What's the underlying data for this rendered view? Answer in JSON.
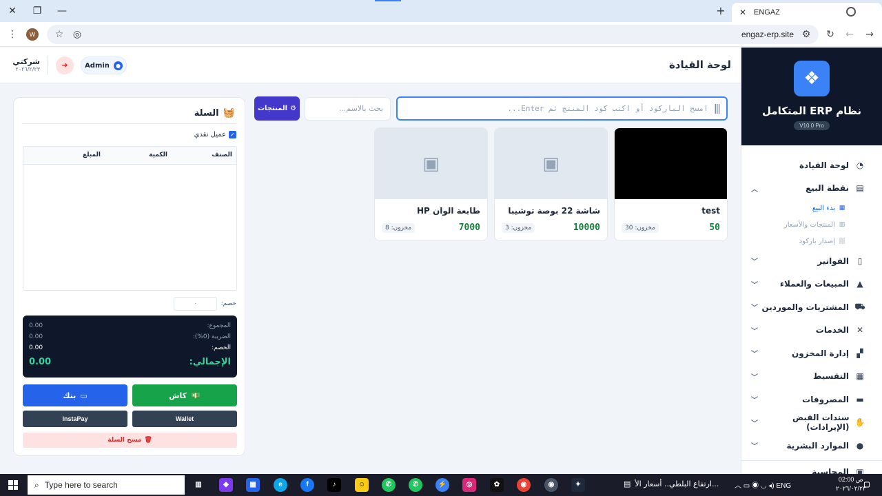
{
  "browser": {
    "tab_title": "ENGAZ",
    "url": "engaz-erp.site",
    "profile_initial": "W"
  },
  "sidebar": {
    "brand_title": "نظام ERP المتكامل",
    "version": "V10.0 Pro",
    "items": [
      {
        "label": "لوحة القيادة",
        "icon": "chart-pie-icon"
      },
      {
        "label": "نقطة البيع",
        "icon": "receipt-icon",
        "expanded": true
      },
      {
        "label": "الفواتير",
        "icon": "file-invoice-icon"
      },
      {
        "label": "المبيعات والعملاء",
        "icon": "shopping-bag-icon"
      },
      {
        "label": "المشتريات والموردين",
        "icon": "shopping-cart-icon"
      },
      {
        "label": "الخدمات",
        "icon": "tools-icon"
      },
      {
        "label": "إدارة المخزون",
        "icon": "boxes-icon"
      },
      {
        "label": "التقسيط",
        "icon": "calendar-icon"
      },
      {
        "label": "المصروفات",
        "icon": "money-icon"
      },
      {
        "label": "سندات القبض (الإيرادات)",
        "icon": "hand-holding-icon"
      },
      {
        "label": "الموارد البشرية",
        "icon": "user-tie-icon"
      },
      {
        "label": "المحاسبة",
        "icon": "calculator-icon"
      }
    ],
    "sub_items": [
      {
        "label": "بدء البيع",
        "active": true
      },
      {
        "label": "المنتجات والأسعار",
        "active": false
      },
      {
        "label": "إصدار باركود",
        "active": false
      }
    ]
  },
  "header": {
    "page_title": "لوحة القيادة",
    "company_name": "شركتي",
    "date": "٢٠٢٦/٢/٢٣",
    "user": "Admin"
  },
  "search": {
    "barcode_placeholder": "امسح الباركود أو اكتب كود المنتج ثم Enter...",
    "name_placeholder": "بحث بالاسم...",
    "products_button": "المنتجات"
  },
  "products": [
    {
      "name": "test",
      "price": "50",
      "stock": "مخزون: 30",
      "has_image": true
    },
    {
      "name": "شاشة 22 بوصة توشيبا",
      "price": "10000",
      "stock": "مخزون: 3",
      "has_image": false
    },
    {
      "name": "طابعة الوان HP",
      "price": "7000",
      "stock": "مخزون: 8",
      "has_image": false
    }
  ],
  "cart": {
    "title": "السلة",
    "cash_customer": "عميل نقدي",
    "columns": {
      "item": "الصنف",
      "qty": "الكمية",
      "amount": "المبلغ"
    },
    "discount_label": "خصم:",
    "discount_value": "٠",
    "subtotal_label": "المجموع:",
    "subtotal": "0.00",
    "tax_label": "الضريبة (0%):",
    "tax": "0.00",
    "discount_total_label": "الخصم:",
    "discount_total": "0.00",
    "grand_label": "الإجمالي:",
    "grand_total": "0.00",
    "cash_button": "كاش",
    "bank_button": "بنك",
    "wallet_button": "Wallet",
    "instapay_button": "InstaPay",
    "clear_button": "مسح السلة"
  },
  "taskbar": {
    "search_placeholder": "Type here to search",
    "news": "ارتفاع البلطي.. أسعار الأ...",
    "lang": "ENG",
    "time": "02:00 ص",
    "date": "٢٠٢٦/٠٢/٢٣"
  },
  "colors": {
    "accent": "#3b82f6",
    "sidebar_dark": "#0f172a",
    "cash": "#16a34a",
    "bank": "#2563eb",
    "products_btn": "#4338ca",
    "danger": "#dc2626"
  }
}
